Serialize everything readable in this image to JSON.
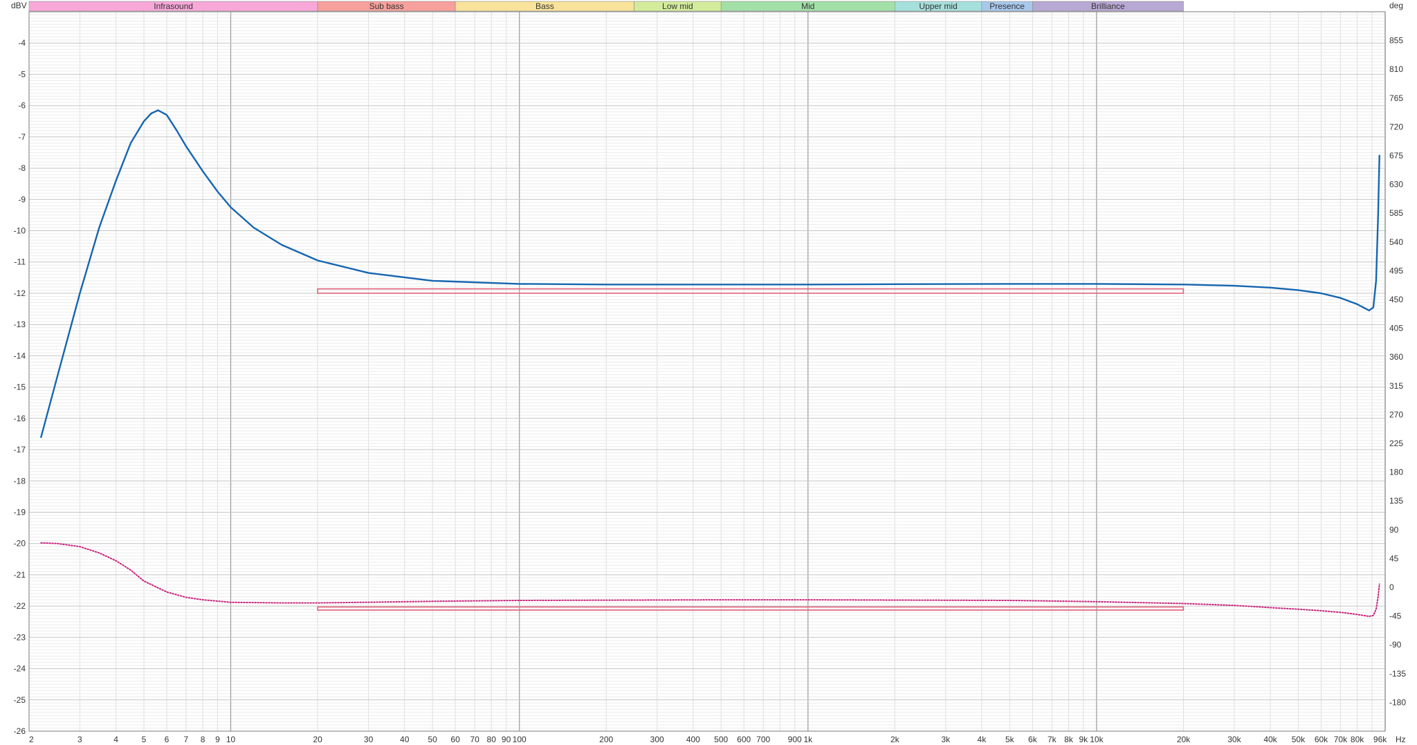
{
  "chart_data": {
    "type": "line",
    "title": "",
    "xlabel": "",
    "ylabel": "",
    "x_scale": "log",
    "x_unit_label": "Hz",
    "xlim": [
      2,
      100000
    ],
    "ylim": [
      -26,
      -3
    ],
    "y_unit_label": "dBV",
    "y2_unit_label": "deg",
    "y2lim": [
      -225,
      900
    ],
    "grid": true,
    "x_ticks": [
      {
        "value": 2,
        "label": "2"
      },
      {
        "value": 3,
        "label": "3"
      },
      {
        "value": 4,
        "label": "4"
      },
      {
        "value": 5,
        "label": "5"
      },
      {
        "value": 6,
        "label": "6"
      },
      {
        "value": 7,
        "label": "7"
      },
      {
        "value": 8,
        "label": "8"
      },
      {
        "value": 9,
        "label": "9"
      },
      {
        "value": 10,
        "label": "10"
      },
      {
        "value": 20,
        "label": "20"
      },
      {
        "value": 30,
        "label": "30"
      },
      {
        "value": 40,
        "label": "40"
      },
      {
        "value": 50,
        "label": "50"
      },
      {
        "value": 60,
        "label": "60"
      },
      {
        "value": 70,
        "label": "70"
      },
      {
        "value": 80,
        "label": "80"
      },
      {
        "value": 90,
        "label": "90"
      },
      {
        "value": 100,
        "label": "100"
      },
      {
        "value": 200,
        "label": "200"
      },
      {
        "value": 300,
        "label": "300"
      },
      {
        "value": 400,
        "label": "400"
      },
      {
        "value": 500,
        "label": "500"
      },
      {
        "value": 600,
        "label": "600"
      },
      {
        "value": 700,
        "label": "700"
      },
      {
        "value": 900,
        "label": "900"
      },
      {
        "value": 1000,
        "label": "1k"
      },
      {
        "value": 2000,
        "label": "2k"
      },
      {
        "value": 3000,
        "label": "3k"
      },
      {
        "value": 4000,
        "label": "4k"
      },
      {
        "value": 5000,
        "label": "5k"
      },
      {
        "value": 6000,
        "label": "6k"
      },
      {
        "value": 7000,
        "label": "7k"
      },
      {
        "value": 8000,
        "label": "8k"
      },
      {
        "value": 9000,
        "label": "9k"
      },
      {
        "value": 10000,
        "label": "10k"
      },
      {
        "value": 20000,
        "label": "20k"
      },
      {
        "value": 30000,
        "label": "30k"
      },
      {
        "value": 40000,
        "label": "40k"
      },
      {
        "value": 50000,
        "label": "50k"
      },
      {
        "value": 60000,
        "label": "60k"
      },
      {
        "value": 70000,
        "label": "70k"
      },
      {
        "value": 80000,
        "label": "80k"
      },
      {
        "value": 96000,
        "label": "96k"
      }
    ],
    "y_ticks": [
      -4,
      -5,
      -6,
      -7,
      -8,
      -9,
      -10,
      -11,
      -12,
      -13,
      -14,
      -15,
      -16,
      -17,
      -18,
      -19,
      -20,
      -21,
      -22,
      -23,
      -24,
      -25,
      -26
    ],
    "y2_ticks": [
      855,
      810,
      765,
      720,
      675,
      630,
      585,
      540,
      495,
      450,
      405,
      360,
      315,
      270,
      225,
      180,
      135,
      90,
      45,
      0,
      -45,
      -90,
      -135,
      -180
    ],
    "bands": [
      {
        "label": "Infrasound",
        "from": 2,
        "to": 20,
        "color": "#f7a8d8"
      },
      {
        "label": "Sub bass",
        "from": 20,
        "to": 60,
        "color": "#f7a09c"
      },
      {
        "label": "Bass",
        "from": 60,
        "to": 250,
        "color": "#f9e29a"
      },
      {
        "label": "Low mid",
        "from": 250,
        "to": 500,
        "color": "#d3ec9c"
      },
      {
        "label": "Mid",
        "from": 500,
        "to": 2000,
        "color": "#a3e0a8"
      },
      {
        "label": "Upper mid",
        "from": 2000,
        "to": 4000,
        "color": "#a6e0dc"
      },
      {
        "label": "Presence",
        "from": 4000,
        "to": 6000,
        "color": "#a8c8ec"
      },
      {
        "label": "Brilliance",
        "from": 6000,
        "to": 20000,
        "color": "#b8a8d4"
      }
    ],
    "series": [
      {
        "axis": "left",
        "color": "#1565b0",
        "style": "solid",
        "x": [
          2.2,
          2.5,
          3,
          3.5,
          4,
          4.5,
          5,
          5.3,
          5.6,
          6,
          6.5,
          7,
          8,
          9,
          10,
          12,
          15,
          20,
          30,
          50,
          100,
          200,
          500,
          1000,
          2000,
          5000,
          10000,
          20000,
          30000,
          40000,
          50000,
          60000,
          70000,
          80000,
          88000,
          91000,
          93000,
          94500,
          95500
        ],
        "y": [
          -16.6,
          -14.7,
          -12.0,
          -9.9,
          -8.4,
          -7.2,
          -6.5,
          -6.25,
          -6.15,
          -6.3,
          -6.8,
          -7.3,
          -8.1,
          -8.75,
          -9.25,
          -9.9,
          -10.45,
          -10.95,
          -11.35,
          -11.6,
          -11.7,
          -11.72,
          -11.72,
          -11.72,
          -11.71,
          -11.7,
          -11.7,
          -11.72,
          -11.76,
          -11.82,
          -11.9,
          -12.0,
          -12.15,
          -12.35,
          -12.55,
          -12.45,
          -11.6,
          -9.5,
          -7.6
        ]
      },
      {
        "axis": "left",
        "color": "#c8207c",
        "style": "dotted",
        "x": [
          2.2,
          2.5,
          3,
          3.5,
          4,
          4.5,
          5,
          6,
          7,
          8,
          10,
          15,
          20,
          50,
          100,
          500,
          1000,
          5000,
          10000,
          20000,
          30000,
          40000,
          50000,
          60000,
          70000,
          80000,
          88000,
          91000,
          93000,
          94500,
          95500
        ],
        "y": [
          -19.98,
          -20.0,
          -20.1,
          -20.3,
          -20.55,
          -20.85,
          -21.2,
          -21.55,
          -21.72,
          -21.8,
          -21.88,
          -21.9,
          -21.9,
          -21.85,
          -21.82,
          -21.8,
          -21.8,
          -21.82,
          -21.86,
          -21.92,
          -21.98,
          -22.05,
          -22.1,
          -22.15,
          -22.2,
          -22.27,
          -22.33,
          -22.3,
          -22.1,
          -21.7,
          -21.3
        ]
      }
    ],
    "target_boxes": [
      {
        "x_from": 20,
        "x_to": 20000,
        "y_from": -11.86,
        "y_to": -12.0,
        "color": "#e0607a"
      },
      {
        "x_from": 20,
        "x_to": 20000,
        "y_from": -22.03,
        "y_to": -22.13,
        "color": "#e0607a"
      }
    ]
  }
}
